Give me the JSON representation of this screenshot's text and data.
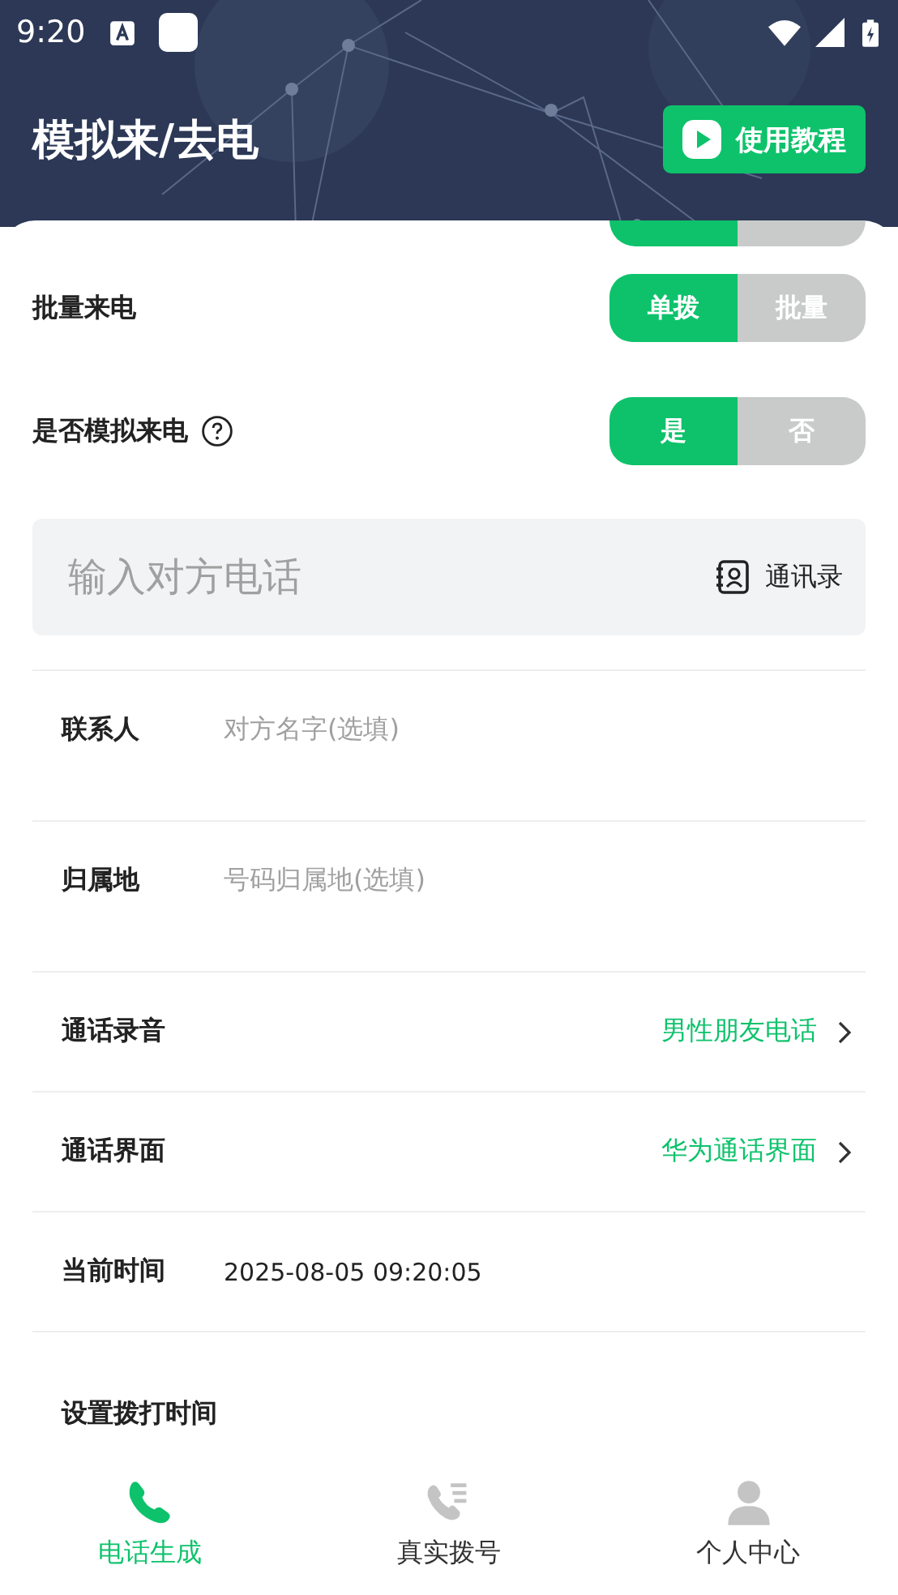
{
  "status_bar": {
    "time": "9:20"
  },
  "header": {
    "title": "模拟来/去电",
    "tutorial_button": "使用教程"
  },
  "hidden_toggle": {
    "options": [
      {
        "selected": true
      },
      {
        "selected": false
      }
    ]
  },
  "toggles": [
    {
      "label": "批量来电",
      "help": false,
      "options": [
        {
          "label": "单拨",
          "selected": true
        },
        {
          "label": "批量",
          "selected": false
        }
      ]
    },
    {
      "label": "是否模拟来电",
      "help": true,
      "options": [
        {
          "label": "是",
          "selected": true
        },
        {
          "label": "否",
          "selected": false
        }
      ]
    }
  ],
  "phone_input": {
    "placeholder": "输入对方电话",
    "contacts_button": "通讯录"
  },
  "fields": [
    {
      "kind": "input",
      "label": "联系人",
      "placeholder": "对方名字(选填)"
    },
    {
      "kind": "input",
      "label": "归属地",
      "placeholder": "号码归属地(选填)"
    },
    {
      "kind": "select",
      "label": "通话录音",
      "value": "男性朋友电话"
    },
    {
      "kind": "select",
      "label": "通话界面",
      "value": "华为通话界面"
    },
    {
      "kind": "text",
      "label": "当前时间",
      "value": "2025-08-05 09:20:05"
    },
    {
      "kind": "heading",
      "label": "设置拨打时间"
    }
  ],
  "bottom_nav": [
    {
      "label": "电话生成",
      "kind": "phone",
      "selected": true
    },
    {
      "label": "真实拨号",
      "kind": "dial",
      "selected": false
    },
    {
      "label": "个人中心",
      "kind": "person",
      "selected": false
    }
  ]
}
